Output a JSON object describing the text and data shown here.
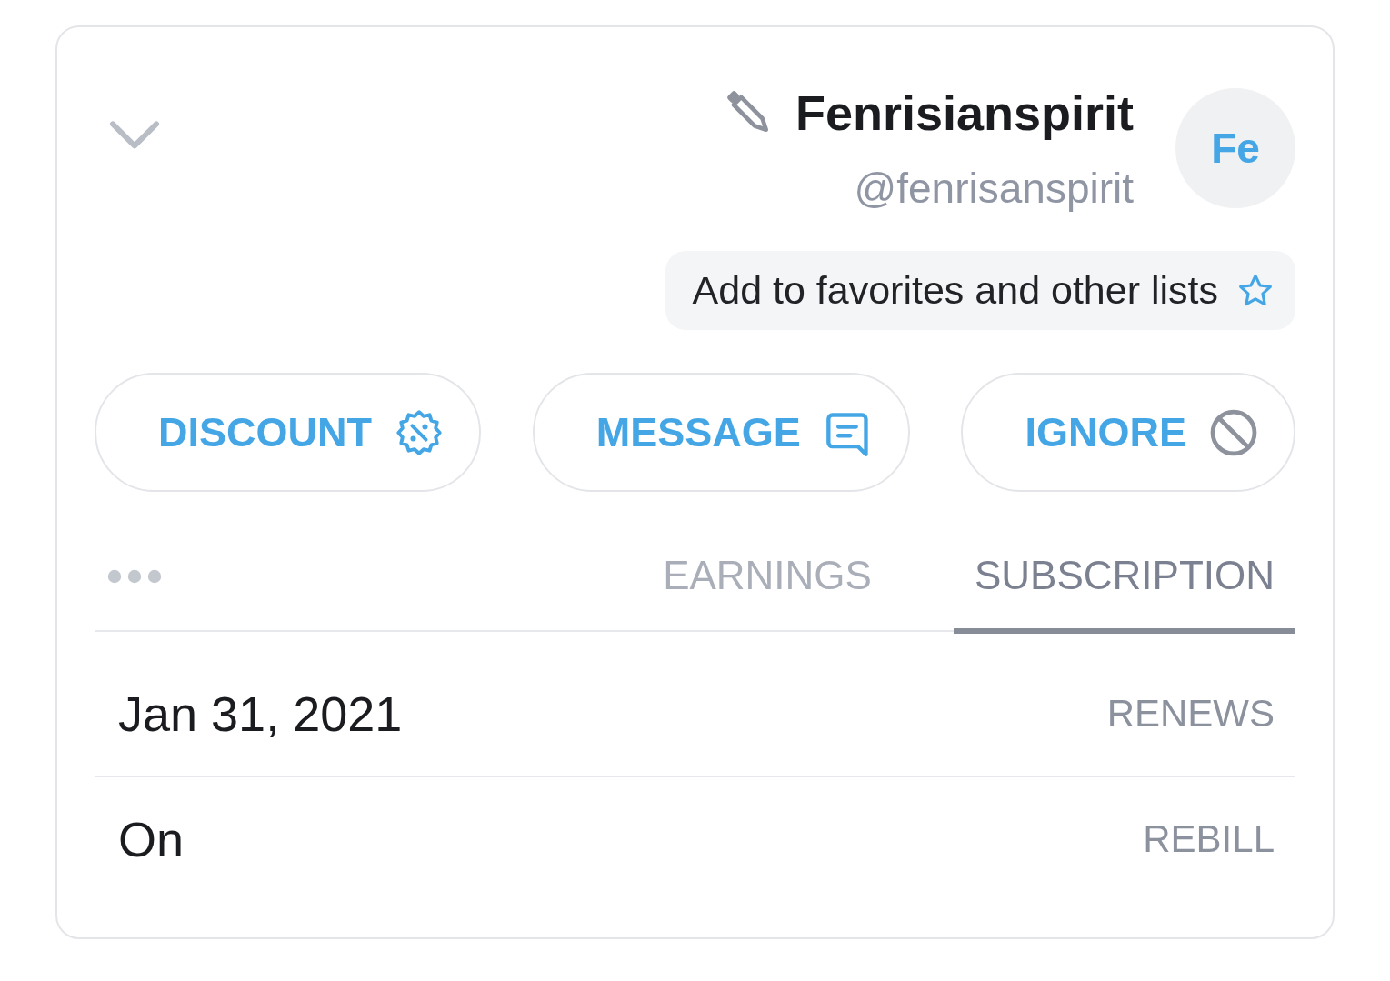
{
  "profile": {
    "avatar_initials": "Fe",
    "name": "Fenrisianspirit",
    "username": "@fenrisanspirit"
  },
  "favorites_button": {
    "label": "Add to favorites and other lists"
  },
  "actions": [
    {
      "kind": "discount",
      "label": "DISCOUNT"
    },
    {
      "kind": "message",
      "label": "MESSAGE"
    },
    {
      "kind": "ignore",
      "label": "IGNORE"
    }
  ],
  "tabs": [
    {
      "label": "EARNINGS",
      "selected": false
    },
    {
      "label": "SUBSCRIPTION",
      "selected": true
    }
  ],
  "details": [
    {
      "label": "RENEWS",
      "value": "Jan 31, 2021"
    },
    {
      "label": "REBILL",
      "value": "On"
    }
  ]
}
